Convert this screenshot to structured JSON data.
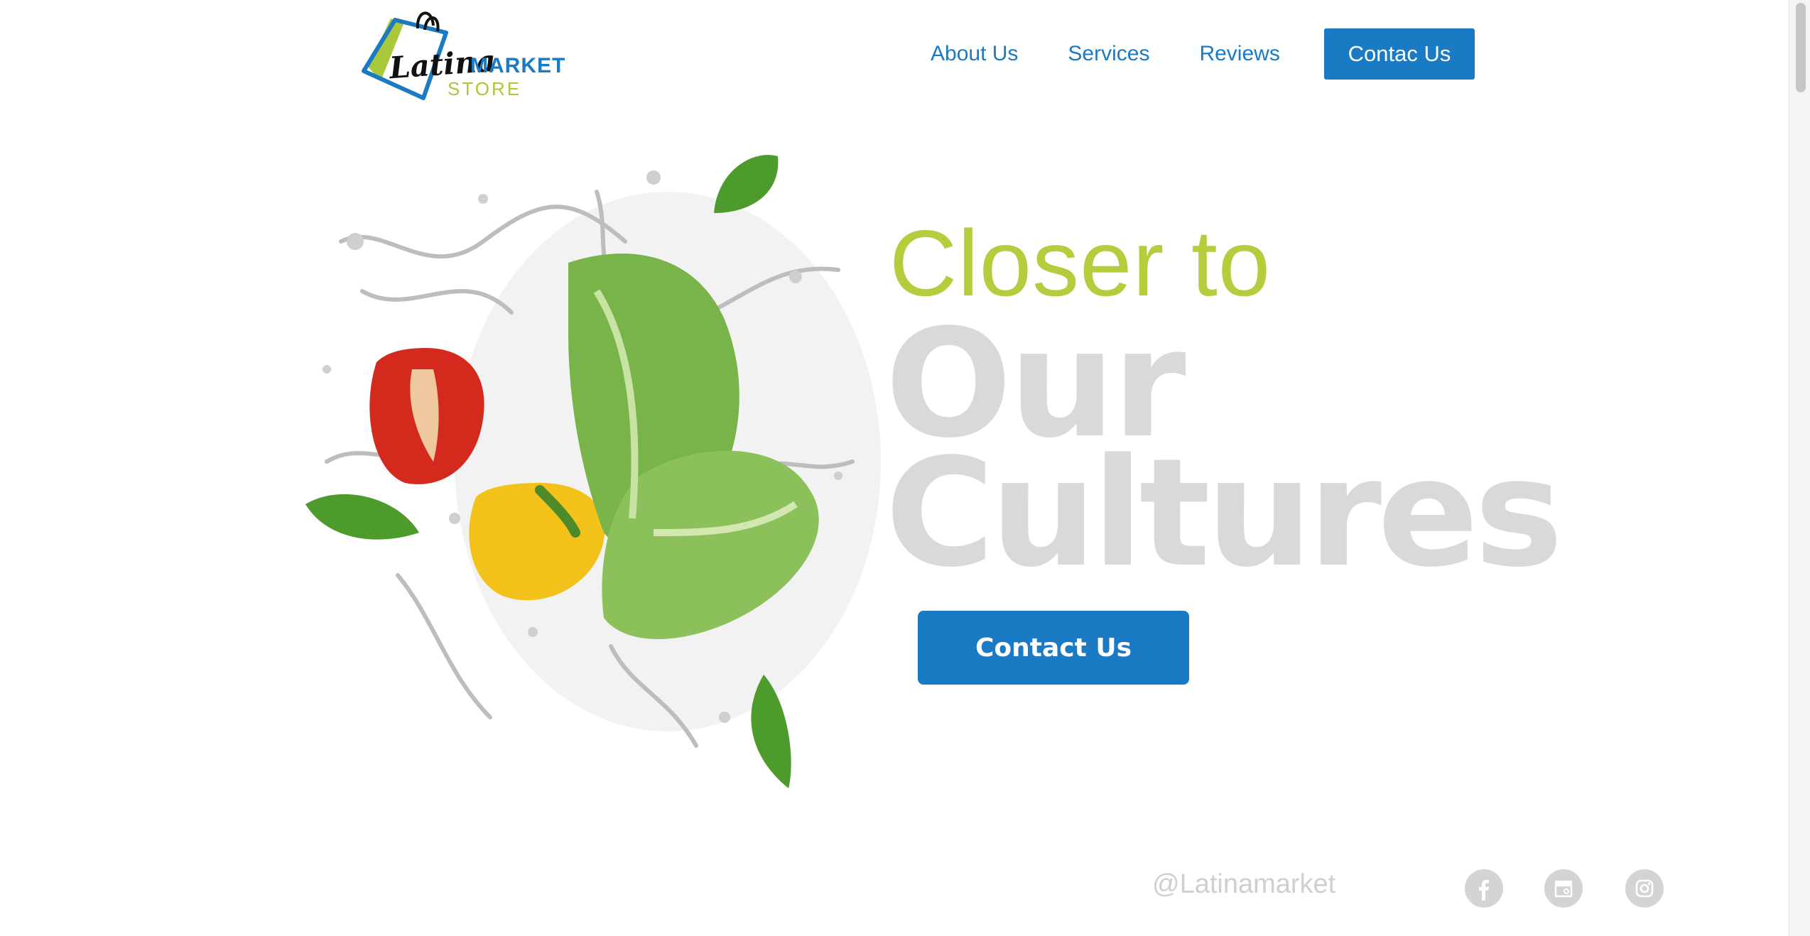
{
  "logo": {
    "script_text": "Latina",
    "market_text": "MARKET",
    "store_text": "STORE"
  },
  "nav": {
    "items": [
      {
        "label": "About Us"
      },
      {
        "label": "Services"
      },
      {
        "label": "Reviews"
      }
    ],
    "cta_label": "Contac Us"
  },
  "hero": {
    "line1": "Closer to",
    "line2": "Our",
    "line3": "Cultures",
    "cta_label": "Contact Us"
  },
  "footer": {
    "handle": "@Latinamarket",
    "social_icons": [
      "facebook-icon",
      "google-business-icon",
      "instagram-icon"
    ]
  },
  "colors": {
    "brand_blue": "#1a7ac4",
    "accent_green": "#b5cc3c",
    "muted_gray": "#d9d9d9"
  }
}
